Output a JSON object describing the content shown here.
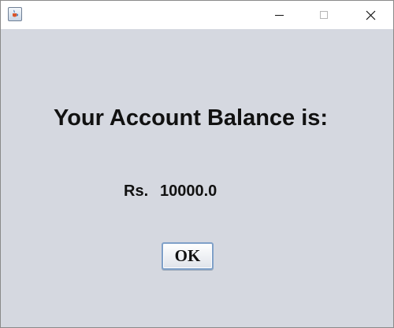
{
  "titlebar": {
    "app_icon": "java-cup-icon",
    "controls": [
      "minimize-icon",
      "maximize-icon",
      "close-icon"
    ]
  },
  "dialog": {
    "heading": "Your Account Balance is:",
    "currency_prefix": "Rs.",
    "balance": "10000.0",
    "ok_label": "OK"
  },
  "colors": {
    "window_background": "#d5d8e0",
    "titlebar_background": "#ffffff",
    "button_border": "#7fa0c8"
  }
}
